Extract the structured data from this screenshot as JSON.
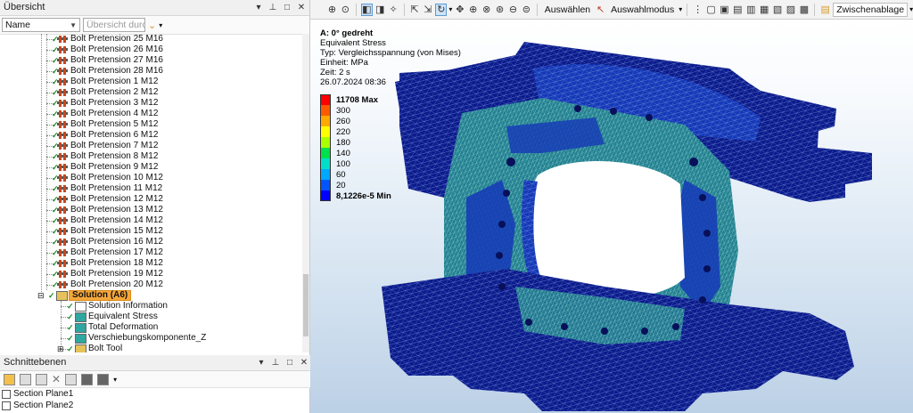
{
  "overview": {
    "title": "Übersicht",
    "name_select": "Name",
    "search_placeholder": "Übersicht durch",
    "items": [
      {
        "label": "Bolt Pretension 25 M16"
      },
      {
        "label": "Bolt Pretension 26 M16"
      },
      {
        "label": "Bolt Pretension 27 M16"
      },
      {
        "label": "Bolt Pretension 28 M16"
      },
      {
        "label": "Bolt Pretension 1 M12"
      },
      {
        "label": "Bolt Pretension 2 M12"
      },
      {
        "label": "Bolt Pretension 3 M12"
      },
      {
        "label": "Bolt Pretension 4 M12"
      },
      {
        "label": "Bolt Pretension 5 M12"
      },
      {
        "label": "Bolt Pretension 6 M12"
      },
      {
        "label": "Bolt Pretension 7 M12"
      },
      {
        "label": "Bolt Pretension 8 M12"
      },
      {
        "label": "Bolt Pretension 9 M12"
      },
      {
        "label": "Bolt Pretension 10 M12"
      },
      {
        "label": "Bolt Pretension 11 M12"
      },
      {
        "label": "Bolt Pretension 12 M12"
      },
      {
        "label": "Bolt Pretension 13 M12"
      },
      {
        "label": "Bolt Pretension 14 M12"
      },
      {
        "label": "Bolt Pretension 15 M12"
      },
      {
        "label": "Bolt Pretension 16 M12"
      },
      {
        "label": "Bolt Pretension 17 M12"
      },
      {
        "label": "Bolt Pretension 18 M12"
      },
      {
        "label": "Bolt Pretension 19 M12"
      },
      {
        "label": "Bolt Pretension 20 M12"
      }
    ],
    "solution": {
      "label": "Solution (A6)",
      "children": [
        {
          "label": "Solution Information",
          "icon": "solution-information-icon"
        },
        {
          "label": "Equivalent Stress",
          "icon": "result-icon"
        },
        {
          "label": "Total Deformation",
          "icon": "result-icon"
        },
        {
          "label": "Verschiebungskomponente_Z",
          "icon": "result-icon"
        },
        {
          "label": "Bolt Tool",
          "icon": "bolt-tool-icon"
        }
      ]
    }
  },
  "section_planes": {
    "title": "Schnittebenen",
    "items": [
      {
        "label": "Section Plane1"
      },
      {
        "label": "Section Plane2"
      }
    ]
  },
  "toolbar": {
    "select_label": "Auswählen",
    "select_mode_label": "Auswahlmodus",
    "clipboard_label": "Zwischenablage"
  },
  "viewport": {
    "info": {
      "title": "A: 0° gedreht",
      "line1": "Equivalent Stress",
      "line2": "Typ: Vergleichsspannung (von Mises)",
      "line3": "Einheit: MPa",
      "line4": "Zeit: 2 s",
      "line5": "26.07.2024 08:36"
    },
    "legend": [
      {
        "label": "11708 Max",
        "color": "#ff0000",
        "bold": true
      },
      {
        "label": "300",
        "color": "#ff5a00"
      },
      {
        "label": "260",
        "color": "#ffaa00"
      },
      {
        "label": "220",
        "color": "#ffff00"
      },
      {
        "label": "180",
        "color": "#aaff00"
      },
      {
        "label": "140",
        "color": "#00e04a"
      },
      {
        "label": "100",
        "color": "#00e0c8"
      },
      {
        "label": "60",
        "color": "#00a8ff"
      },
      {
        "label": "20",
        "color": "#0055ff"
      },
      {
        "label": "8,1226e-5 Min",
        "color": "#0000ff",
        "bold": true
      }
    ]
  },
  "colors": {
    "model_dark": "#0b1a8c",
    "model_mid": "#1538b8",
    "model_stress": "#1f7f8f",
    "mesh_line": "#7fa0e0",
    "selection_highlight": "#f5a73b"
  }
}
